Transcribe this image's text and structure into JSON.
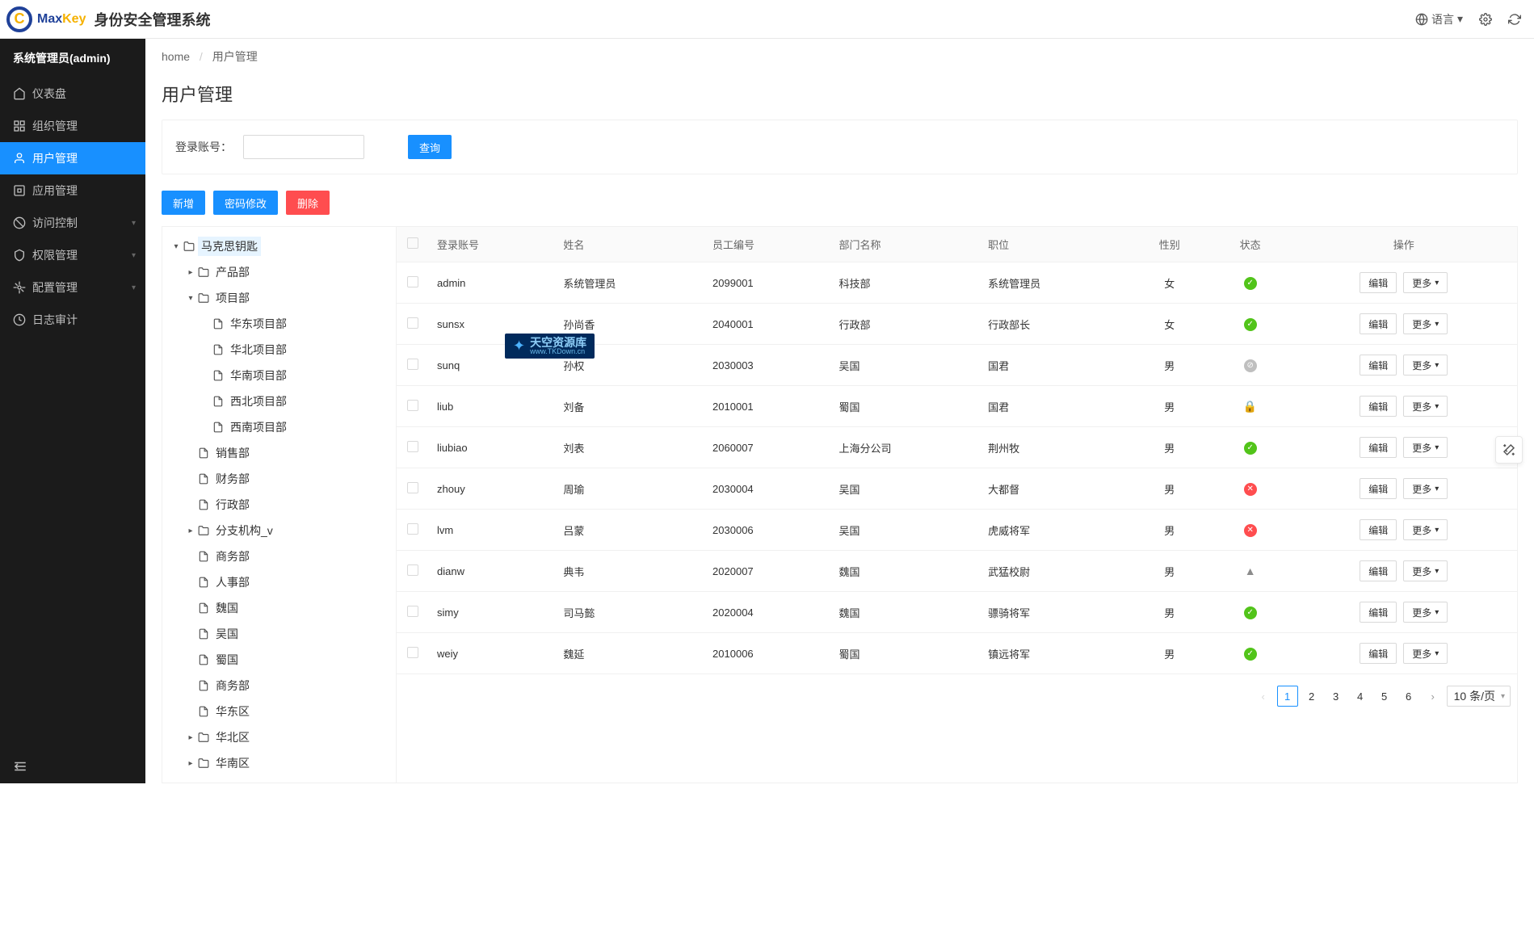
{
  "header": {
    "logo_letter": "C",
    "logo_max": "Max",
    "logo_key": "Key",
    "system_name": "身份安全管理系统",
    "language": "语言",
    "language_caret": "▾"
  },
  "sidebar": {
    "user": "系统管理员(admin)",
    "items": [
      {
        "label": "仪表盘"
      },
      {
        "label": "组织管理"
      },
      {
        "label": "用户管理"
      },
      {
        "label": "应用管理"
      },
      {
        "label": "访问控制"
      },
      {
        "label": "权限管理"
      },
      {
        "label": "配置管理"
      },
      {
        "label": "日志审计"
      }
    ]
  },
  "breadcrumb": {
    "home": "home",
    "current": "用户管理"
  },
  "page_title": "用户管理",
  "search": {
    "label": "登录账号：",
    "button": "查询"
  },
  "toolbar": {
    "add": "新增",
    "pwd": "密码修改",
    "del": "删除"
  },
  "tree": [
    {
      "level": 0,
      "expand": "open",
      "type": "folder",
      "label": "马克思钥匙",
      "selected": true
    },
    {
      "level": 1,
      "expand": "closed",
      "type": "folder",
      "label": "产品部"
    },
    {
      "level": 1,
      "expand": "open",
      "type": "folder",
      "label": "项目部"
    },
    {
      "level": 2,
      "expand": "none",
      "type": "file",
      "label": "华东项目部"
    },
    {
      "level": 2,
      "expand": "none",
      "type": "file",
      "label": "华北项目部"
    },
    {
      "level": 2,
      "expand": "none",
      "type": "file",
      "label": "华南项目部"
    },
    {
      "level": 2,
      "expand": "none",
      "type": "file",
      "label": "西北项目部"
    },
    {
      "level": 2,
      "expand": "none",
      "type": "file",
      "label": "西南项目部"
    },
    {
      "level": 1,
      "expand": "none",
      "type": "file",
      "label": "销售部"
    },
    {
      "level": 1,
      "expand": "none",
      "type": "file",
      "label": "财务部"
    },
    {
      "level": 1,
      "expand": "none",
      "type": "file",
      "label": "行政部"
    },
    {
      "level": 1,
      "expand": "closed",
      "type": "folder",
      "label": "分支机构_v"
    },
    {
      "level": 1,
      "expand": "none",
      "type": "file",
      "label": "商务部"
    },
    {
      "level": 1,
      "expand": "none",
      "type": "file",
      "label": "人事部"
    },
    {
      "level": 1,
      "expand": "none",
      "type": "file",
      "label": "魏国"
    },
    {
      "level": 1,
      "expand": "none",
      "type": "file",
      "label": "吴国"
    },
    {
      "level": 1,
      "expand": "none",
      "type": "file",
      "label": "蜀国"
    },
    {
      "level": 1,
      "expand": "none",
      "type": "file",
      "label": "商务部"
    },
    {
      "level": 1,
      "expand": "none",
      "type": "file",
      "label": "华东区"
    },
    {
      "level": 1,
      "expand": "closed",
      "type": "folder",
      "label": "华北区"
    },
    {
      "level": 1,
      "expand": "closed",
      "type": "folder",
      "label": "华南区"
    }
  ],
  "table": {
    "cols": [
      "登录账号",
      "姓名",
      "员工编号",
      "部门名称",
      "职位",
      "性别",
      "状态",
      "操作"
    ],
    "edit": "编辑",
    "more": "更多",
    "rows": [
      {
        "login": "admin",
        "name": "系统管理员",
        "empno": "2099001",
        "dept": "科技部",
        "position": "系统管理员",
        "gender": "女",
        "status": "active"
      },
      {
        "login": "sunsx",
        "name": "孙尚香",
        "empno": "2040001",
        "dept": "行政部",
        "position": "行政部长",
        "gender": "女",
        "status": "active"
      },
      {
        "login": "sunq",
        "name": "孙权",
        "empno": "2030003",
        "dept": "吴国",
        "position": "国君",
        "gender": "男",
        "status": "disabled"
      },
      {
        "login": "liub",
        "name": "刘备",
        "empno": "2010001",
        "dept": "蜀国",
        "position": "国君",
        "gender": "男",
        "status": "locked"
      },
      {
        "login": "liubiao",
        "name": "刘表",
        "empno": "2060007",
        "dept": "上海分公司",
        "position": "荆州牧",
        "gender": "男",
        "status": "active"
      },
      {
        "login": "zhouy",
        "name": "周瑜",
        "empno": "2030004",
        "dept": "吴国",
        "position": "大都督",
        "gender": "男",
        "status": "inactive"
      },
      {
        "login": "lvm",
        "name": "吕蒙",
        "empno": "2030006",
        "dept": "吴国",
        "position": "虎威将军",
        "gender": "男",
        "status": "inactive"
      },
      {
        "login": "dianw",
        "name": "典韦",
        "empno": "2020007",
        "dept": "魏国",
        "position": "武猛校尉",
        "gender": "男",
        "status": "warn"
      },
      {
        "login": "simy",
        "name": "司马懿",
        "empno": "2020004",
        "dept": "魏国",
        "position": "骠骑将军",
        "gender": "男",
        "status": "active"
      },
      {
        "login": "weiy",
        "name": "魏延",
        "empno": "2010006",
        "dept": "蜀国",
        "position": "镇远将军",
        "gender": "男",
        "status": "active"
      }
    ]
  },
  "pagination": {
    "pages": [
      "1",
      "2",
      "3",
      "4",
      "5",
      "6"
    ],
    "active": "1",
    "pagesize": "10 条/页"
  },
  "watermark": {
    "main": "天空资源库",
    "sub": "www.TKDown.cn"
  }
}
